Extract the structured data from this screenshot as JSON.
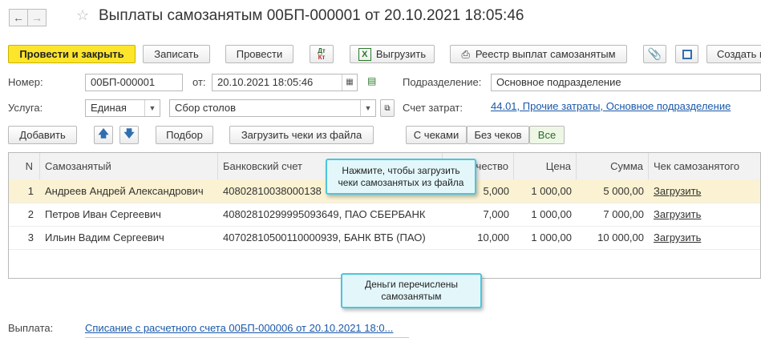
{
  "title": "Выплаты самозанятым 00БП-000001 от 20.10.2021 18:05:46",
  "toolbar": {
    "post_close": "Провести и закрыть",
    "save": "Записать",
    "post": "Провести",
    "dt_kt_top": "Дт",
    "dt_kt_bottom": "Кт",
    "export": "Выгрузить",
    "registry": "Реестр выплат самозанятым",
    "create": "Создать н"
  },
  "form": {
    "number_label": "Номер:",
    "number_value": "00БП-000001",
    "date_label": "от:",
    "date_value": "20.10.2021 18:05:46",
    "division_label": "Подразделение:",
    "division_value": "Основное подразделение",
    "service_label": "Услуга:",
    "service_type": "Единая",
    "service_name": "Сбор столов",
    "account_label": "Счет затрат:",
    "account_value": "44.01, Прочие затраты, Основное подразделение"
  },
  "table_toolbar": {
    "add": "Добавить",
    "pick": "Подбор",
    "load_receipts": "Загрузить чеки из файла",
    "filters": [
      "С чеками",
      "Без чеков",
      "Все"
    ]
  },
  "table": {
    "headers": [
      "N",
      "Самозанятый",
      "Банковский счет",
      "чество",
      "Цена",
      "Сумма",
      "Чек самозанятого"
    ],
    "rows": [
      {
        "n": "1",
        "name": "Андреев Андрей Александрович",
        "account": "40802810038000138",
        "qty": "5,000",
        "price": "1 000,00",
        "sum": "5 000,00",
        "receipt": "Загрузить"
      },
      {
        "n": "2",
        "name": "Петров Иван Сергеевич",
        "account": "40802810299995093649, ПАО СБЕРБАНК",
        "qty": "7,000",
        "price": "1 000,00",
        "sum": "7 000,00",
        "receipt": "Загрузить"
      },
      {
        "n": "3",
        "name": "Ильин Вадим Сергеевич",
        "account": "40702810500110000939, БАНК ВТБ (ПАО)",
        "qty": "10,000",
        "price": "1 000,00",
        "sum": "10 000,00",
        "receipt": "Загрузить"
      }
    ]
  },
  "callouts": {
    "load_hint": "Нажмите, чтобы загрузить чеки самозанятых из файла",
    "paid_hint": "Деньги перечислены самозанятым"
  },
  "payment": {
    "label": "Выплата:",
    "link": "Списание с расчетного счета 00БП-000006 от 20.10.2021 18:0..."
  },
  "colors": {
    "primary_button": "#fce52b",
    "link": "#1a58a8",
    "receipt_link": "#d0231a",
    "selected_row": "#faf2d2",
    "callout_border": "#4cc6dd",
    "callout_fill": "#e3f7fb"
  }
}
